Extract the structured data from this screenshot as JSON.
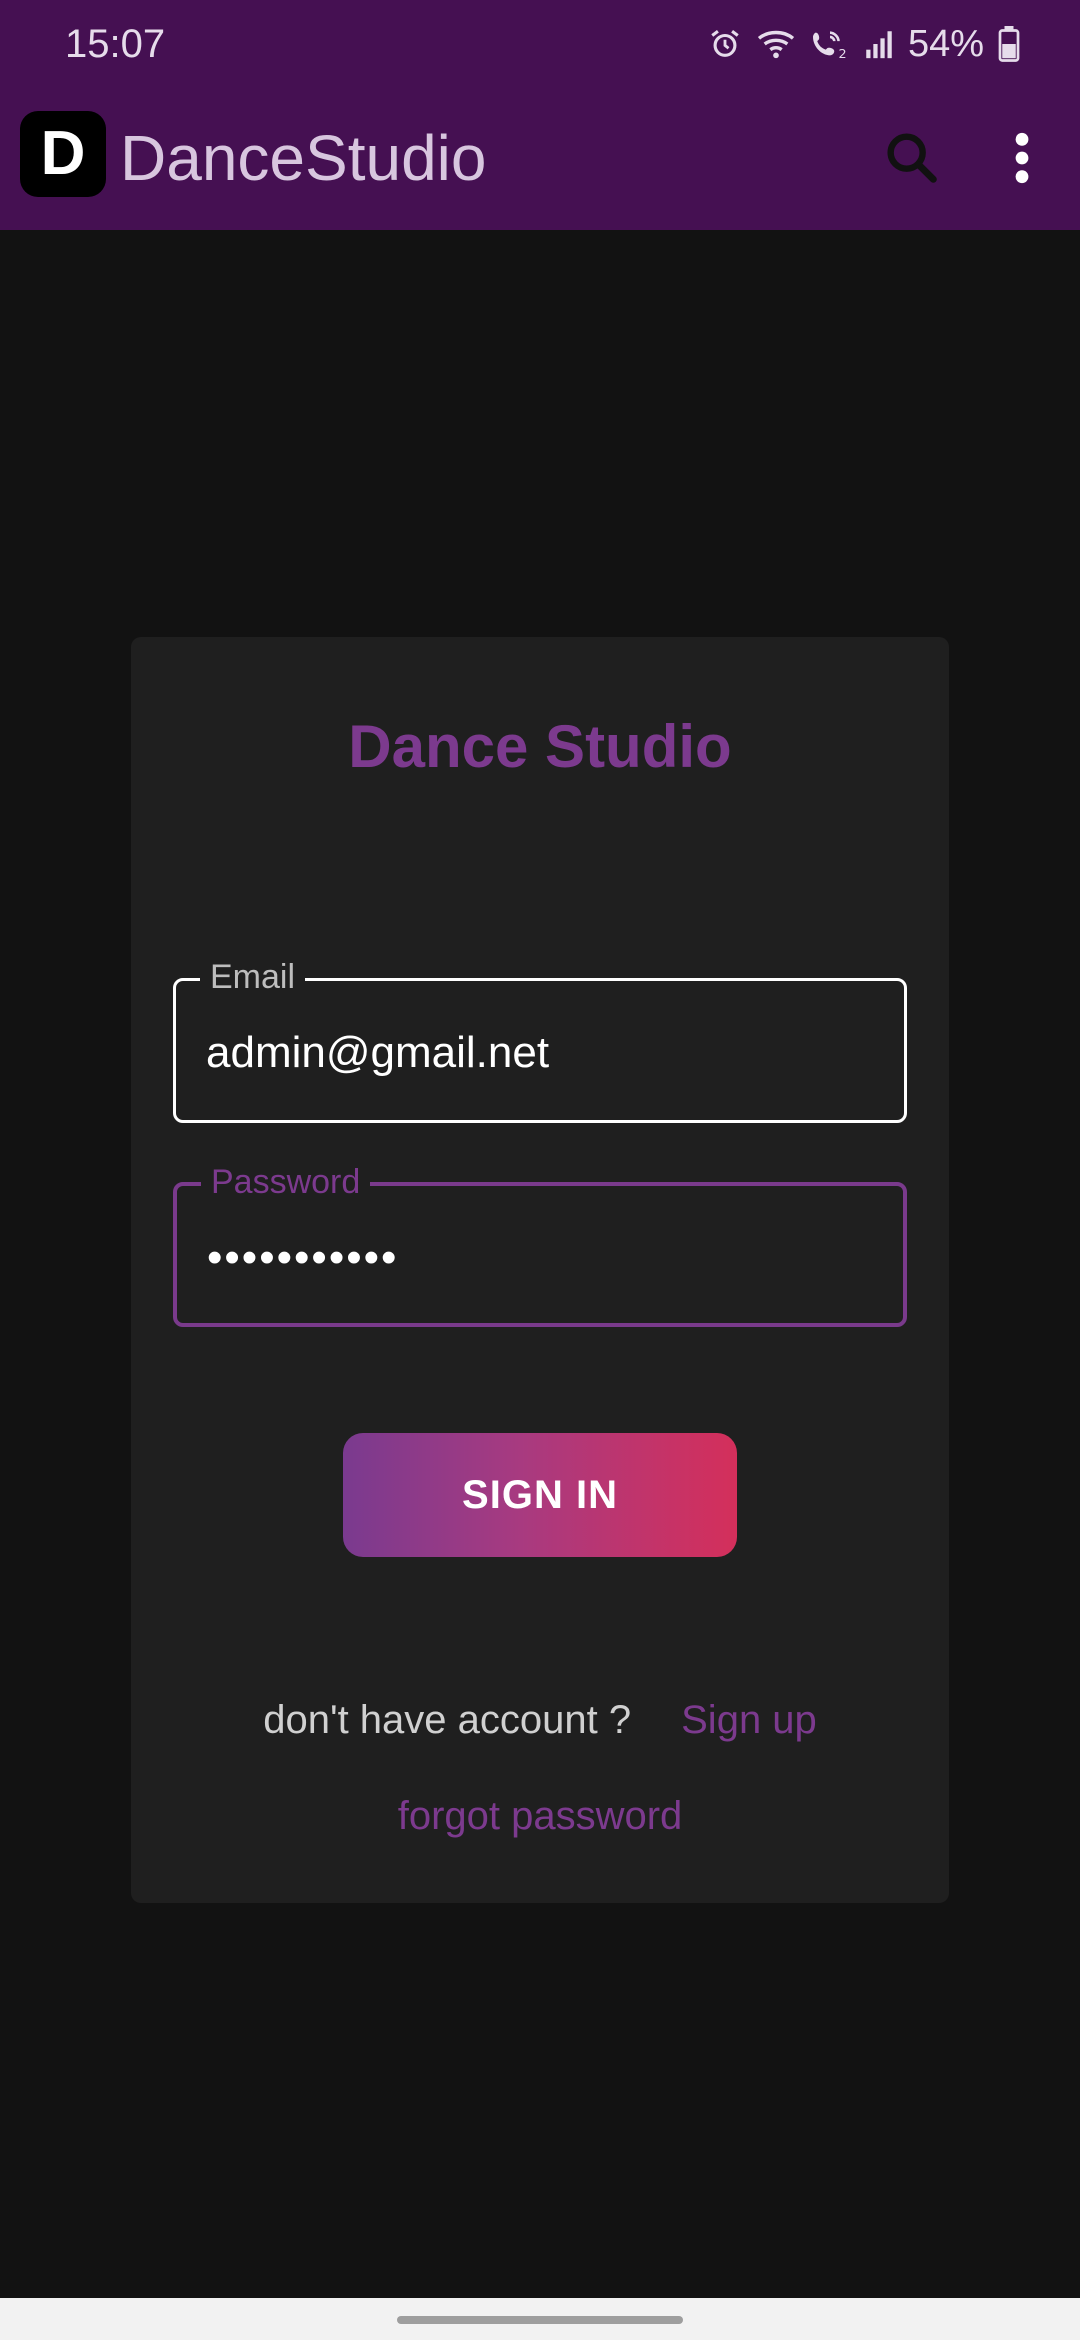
{
  "status_bar": {
    "time": "15:07",
    "battery": "54%",
    "icons": [
      "alarm-icon",
      "wifi-icon",
      "wifi-calling-icon",
      "signal-icon",
      "battery-icon"
    ]
  },
  "app_bar": {
    "logo_letter": "D",
    "title": "DanceStudio",
    "actions": [
      "search-icon",
      "more-vert-icon"
    ]
  },
  "login": {
    "title": "Dance Studio",
    "email": {
      "label": "Email",
      "value": "admin@gmail.net"
    },
    "password": {
      "label": "Password",
      "value": "•••••••••••"
    },
    "sign_in_label": "SIGN IN",
    "signup_prompt": "don't have account ?",
    "signup_link": "Sign up",
    "forgot_password": "forgot password"
  },
  "colors": {
    "app_bar": "#451052",
    "accent": "#7c3a8e",
    "button_gradient_start": "#7a3a8f",
    "button_gradient_end": "#d42f5b",
    "background": "#121212",
    "card": "#1f1f1f"
  }
}
